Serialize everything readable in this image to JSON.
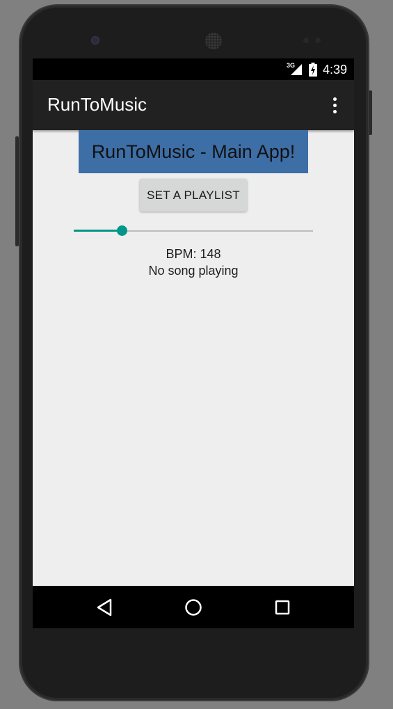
{
  "status_bar": {
    "network": "3G",
    "time": "4:39"
  },
  "app_bar": {
    "title": "RunToMusic",
    "overflow_icon": "more-vert-icon"
  },
  "main": {
    "banner_text": "RunToMusic - Main App!",
    "set_playlist_label": "SET A PLAYLIST",
    "bpm_text": "BPM: 148",
    "song_status": "No song playing",
    "seekbar_level": 0.2
  },
  "nav_bar": {
    "back_icon": "back-triangle-icon",
    "home_icon": "home-circle-icon",
    "recents_icon": "recents-square-icon"
  },
  "colors": {
    "accent": "#009688",
    "banner": "#3d6ea6",
    "app_bar": "#212121",
    "background": "#eeeeee"
  }
}
